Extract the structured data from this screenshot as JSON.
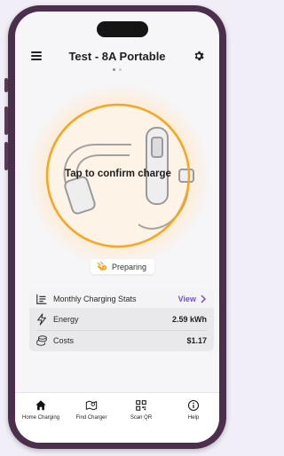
{
  "header": {
    "title": "Test - 8A Portable",
    "menu_icon": "hamburger-menu-icon",
    "settings_icon": "gear-icon"
  },
  "pager": {
    "count": 2,
    "active_index": 0
  },
  "charger": {
    "action_label": "Tap to confirm charge",
    "status": "Preparing",
    "ring_color": "#f5a623",
    "glow_color": "#fde7c8"
  },
  "stats": {
    "title": "Monthly Charging Stats",
    "view_label": "View",
    "energy_label": "Energy",
    "energy_value": "2.59 kWh",
    "costs_label": "Costs",
    "costs_value": "$1.17",
    "accent": "#7a4fc7"
  },
  "nav": {
    "items": [
      {
        "label": "Home Charging",
        "icon": "home-icon"
      },
      {
        "label": "Find Charger",
        "icon": "map-icon"
      },
      {
        "label": "Scan QR",
        "icon": "qr-code-icon"
      },
      {
        "label": "Help",
        "icon": "info-icon"
      }
    ]
  }
}
